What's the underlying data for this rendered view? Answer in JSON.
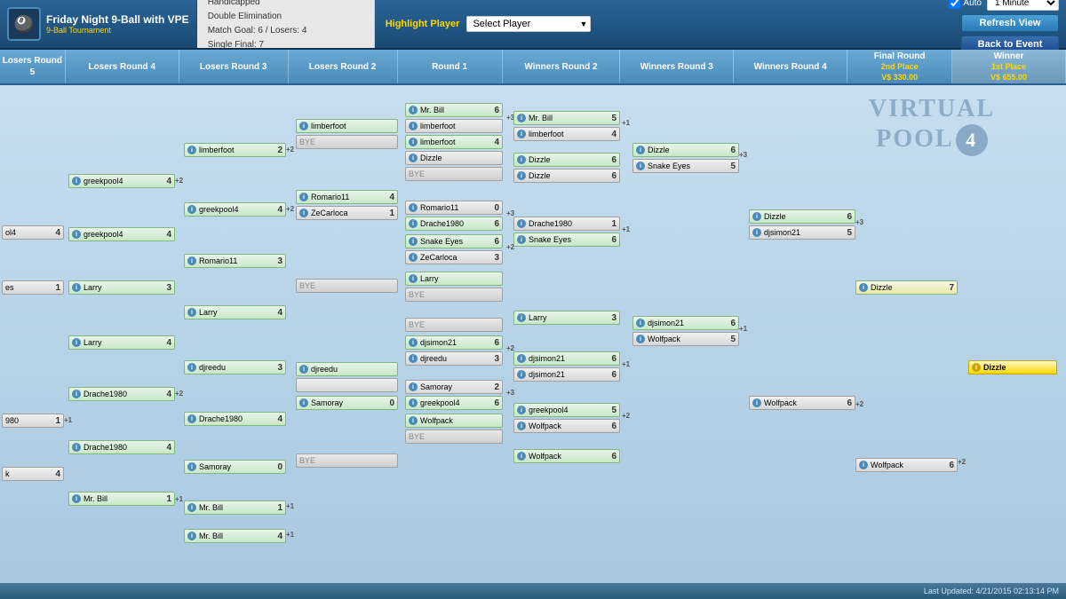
{
  "topbar": {
    "title": "Friday Night 9-Ball with VPE",
    "subtitle": "9-Ball Tournament",
    "format": "Handicapped\nDouble Elimination",
    "match_goal": "Match Goal: 6 / Losers: 4",
    "single_final": "Single Final: 7",
    "highlight_label": "Highlight Player",
    "highlight_placeholder": "Select Player",
    "auto_label": "Auto",
    "auto_option": "1 Minute",
    "refresh_btn": "Refresh View",
    "back_btn": "Back to Event"
  },
  "columns": [
    {
      "id": "lr5",
      "label": "Losers Round 5",
      "prize": ""
    },
    {
      "id": "lr4",
      "label": "Losers Round 4",
      "prize": ""
    },
    {
      "id": "lr3",
      "label": "Losers Round 3",
      "prize": ""
    },
    {
      "id": "lr2",
      "label": "Losers Round 2",
      "prize": ""
    },
    {
      "id": "r1",
      "label": "Round 1",
      "prize": ""
    },
    {
      "id": "wr2",
      "label": "Winners Round 2",
      "prize": ""
    },
    {
      "id": "wr3",
      "label": "Winners Round 3",
      "prize": ""
    },
    {
      "id": "wr4",
      "label": "Winners Round 4",
      "prize": ""
    },
    {
      "id": "fr",
      "label": "Final Round",
      "prize": "2nd Place\nV$ 330.00"
    },
    {
      "id": "winner",
      "label": "Winner",
      "prize": "1st Place\nV$ 655.00"
    }
  ],
  "status": "Last Updated: 4/21/2015 02:13:14 PM",
  "logo": {
    "text": "VIRTUAL\nPOOL",
    "number": "4"
  }
}
